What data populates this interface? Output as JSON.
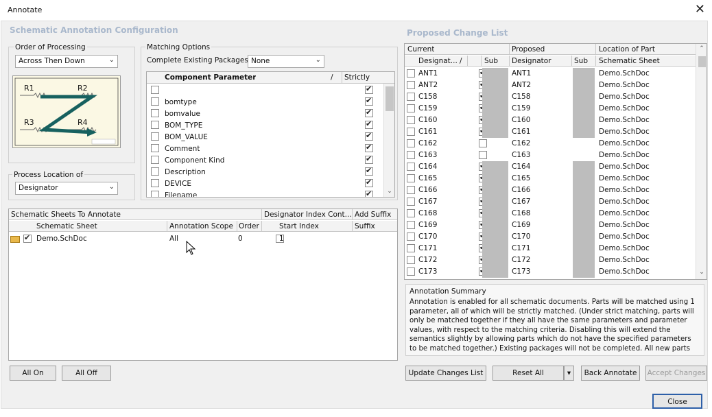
{
  "window": {
    "title": "Annotate",
    "close_glyph": "✕"
  },
  "config": {
    "section_title": "Schematic Annotation Configuration",
    "order_of_processing": {
      "label": "Order of Processing",
      "value": "Across Then Down",
      "diagram_labels": [
        "R1",
        "R2",
        "R3",
        "R4"
      ]
    },
    "process_location": {
      "label": "Process Location of",
      "value": "Designator"
    },
    "matching_options": {
      "label": "Matching Options",
      "complete_existing_label": "Complete Existing Packages",
      "complete_existing_value": "None",
      "col_param": "Component Parameter",
      "col_sort": "/",
      "col_strictly": "Strictly",
      "rows": [
        {
          "name": "",
          "checked": false,
          "strictly": true
        },
        {
          "name": "bomtype",
          "checked": false,
          "strictly": true
        },
        {
          "name": "bomvalue",
          "checked": false,
          "strictly": true
        },
        {
          "name": "BOM_TYPE",
          "checked": false,
          "strictly": true
        },
        {
          "name": "BOM_VALUE",
          "checked": false,
          "strictly": true
        },
        {
          "name": "Comment",
          "checked": false,
          "strictly": true
        },
        {
          "name": "Component Kind",
          "checked": false,
          "strictly": true
        },
        {
          "name": "Description",
          "checked": false,
          "strictly": true
        },
        {
          "name": "DEVICE",
          "checked": false,
          "strictly": true
        },
        {
          "name": "Filename",
          "checked": false,
          "strictly": true
        }
      ]
    },
    "sheets": {
      "group1": "Schematic Sheets To Annotate",
      "group2": "Designator Index Cont...",
      "group3": "Add Suffix",
      "col_sheet": "Schematic Sheet",
      "col_scope": "Annotation Scope",
      "col_order": "Order",
      "col_start": "Start Index",
      "col_suffix": "Suffix",
      "rows": [
        {
          "sheet": "Demo.SchDoc",
          "checked": true,
          "scope": "All",
          "order": "0",
          "start_checked": false,
          "start": "1",
          "suffix": ""
        }
      ]
    },
    "buttons": {
      "all_on": "All On",
      "all_off": "All Off"
    }
  },
  "proposed": {
    "section_title": "Proposed Change List",
    "groups": {
      "current": "Current",
      "proposed": "Proposed",
      "location": "Location of Part"
    },
    "cols": {
      "designator": "Designat...",
      "sort": "/",
      "sub": "Sub",
      "p_designator": "Designator",
      "p_sub": "Sub",
      "sheet": "Schematic Sheet"
    },
    "rows": [
      {
        "cur": "ANT1",
        "chk": true,
        "prop": "ANT1",
        "sheet": "Demo.SchDoc"
      },
      {
        "cur": "ANT2",
        "chk": true,
        "prop": "ANT2",
        "sheet": "Demo.SchDoc"
      },
      {
        "cur": "C158",
        "chk": true,
        "prop": "C158",
        "sheet": "Demo.SchDoc"
      },
      {
        "cur": "C159",
        "chk": true,
        "prop": "C159",
        "sheet": "Demo.SchDoc"
      },
      {
        "cur": "C160",
        "chk": true,
        "prop": "C160",
        "sheet": "Demo.SchDoc"
      },
      {
        "cur": "C161",
        "chk": true,
        "prop": "C161",
        "sheet": "Demo.SchDoc"
      },
      {
        "cur": "C162",
        "chk": false,
        "prop": "C162",
        "sheet": "Demo.SchDoc"
      },
      {
        "cur": "C163",
        "chk": false,
        "prop": "C163",
        "sheet": "Demo.SchDoc"
      },
      {
        "cur": "C164",
        "chk": true,
        "prop": "C164",
        "sheet": "Demo.SchDoc"
      },
      {
        "cur": "C165",
        "chk": true,
        "prop": "C165",
        "sheet": "Demo.SchDoc"
      },
      {
        "cur": "C166",
        "chk": true,
        "prop": "C166",
        "sheet": "Demo.SchDoc"
      },
      {
        "cur": "C167",
        "chk": true,
        "prop": "C167",
        "sheet": "Demo.SchDoc"
      },
      {
        "cur": "C168",
        "chk": true,
        "prop": "C168",
        "sheet": "Demo.SchDoc"
      },
      {
        "cur": "C169",
        "chk": true,
        "prop": "C169",
        "sheet": "Demo.SchDoc"
      },
      {
        "cur": "C170",
        "chk": true,
        "prop": "C170",
        "sheet": "Demo.SchDoc"
      },
      {
        "cur": "C171",
        "chk": true,
        "prop": "C171",
        "sheet": "Demo.SchDoc"
      },
      {
        "cur": "C172",
        "chk": true,
        "prop": "C172",
        "sheet": "Demo.SchDoc"
      },
      {
        "cur": "C173",
        "chk": true,
        "prop": "C173",
        "sheet": "Demo.SchDoc"
      }
    ],
    "summary_title": "Annotation Summary",
    "summary_text": "Annotation is enabled for all schematic documents. Parts will be matched using 1 parameter, all of which will be strictly matched. (Under strict matching, parts will only be matched together if they all have the same parameters and parameter values, with respect to the matching criteria. Disabling this will extend the semantics slightly by allowing parts which do not have the specified parameters to be matched together.) Existing packages will not be completed. All new parts",
    "buttons": {
      "update": "Update Changes List",
      "reset": "Reset All",
      "back_annotate": "Back Annotate",
      "accept": "Accept Changes"
    }
  },
  "footer": {
    "close": "Close"
  },
  "colors": {
    "section_title": "#a9b8cc",
    "diagram_arrow": "#17615f",
    "diagram_bg": "#fbf8e4"
  }
}
